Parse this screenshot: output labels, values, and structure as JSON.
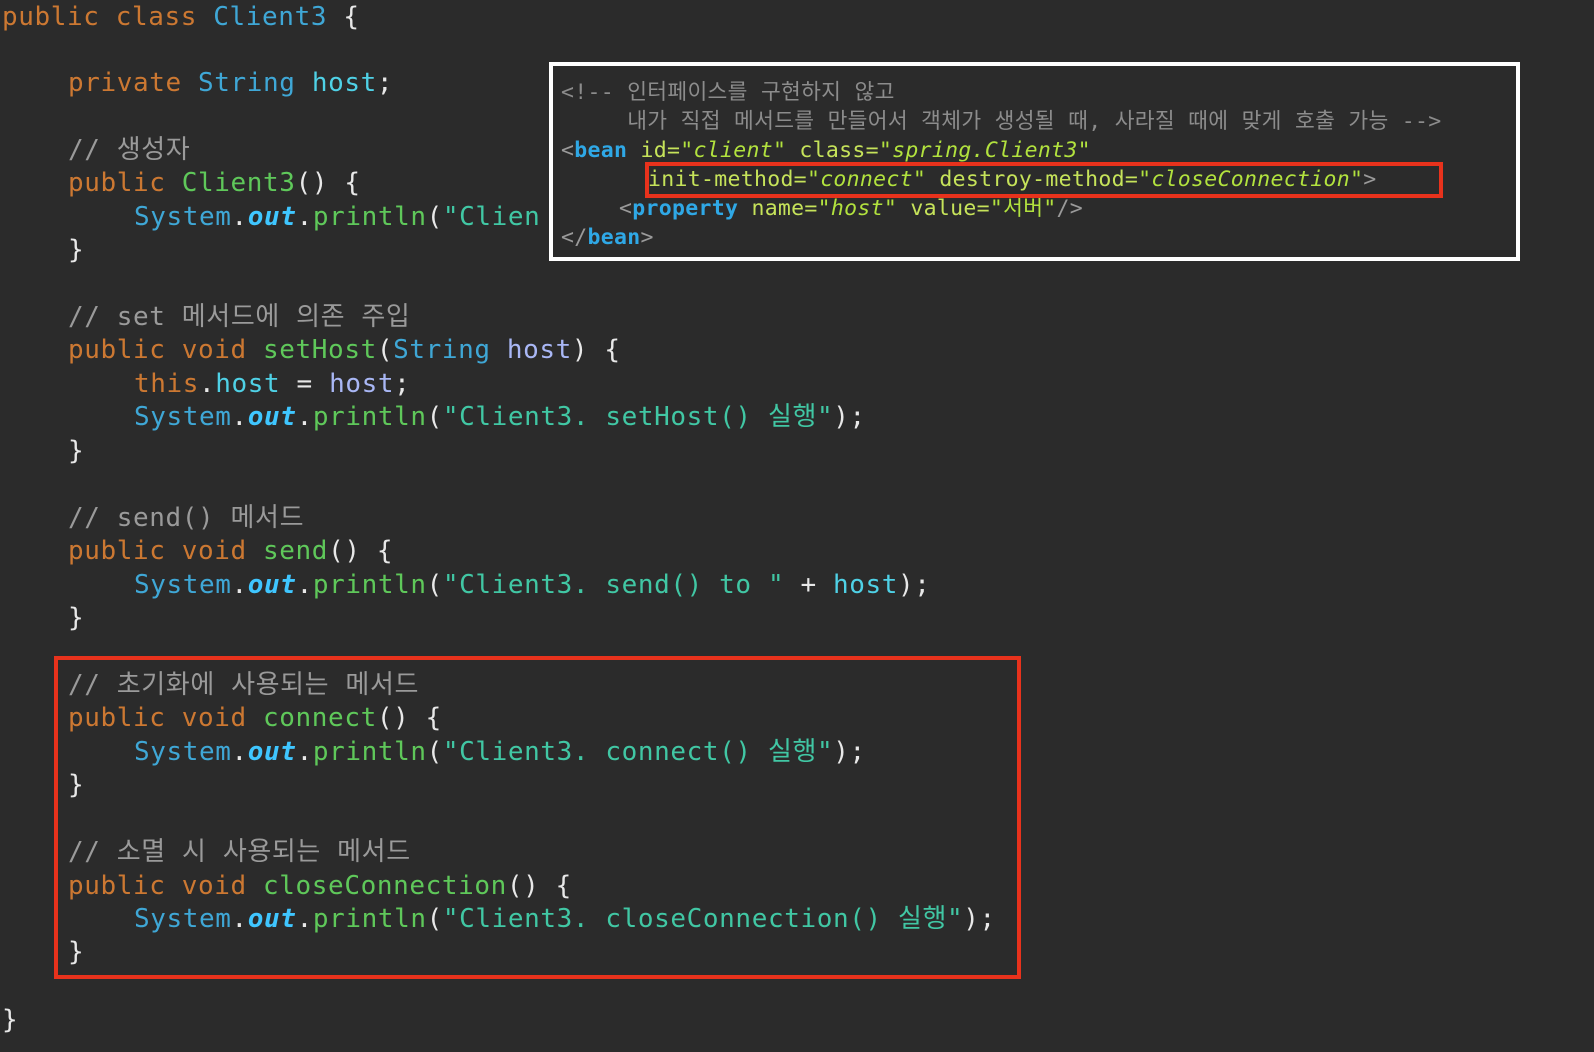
{
  "code": {
    "class_open": {
      "kw": "public class ",
      "name": "Client3",
      "brace": " {"
    },
    "field": {
      "kw": "private ",
      "type": "String",
      "name": "host",
      "semi": ";"
    },
    "ctor_comment": "// 생성자",
    "ctor_sig": {
      "kw": "public ",
      "name": "Client3",
      "rest": "() {"
    },
    "ctor_body": {
      "sys": "System",
      "dot1": ".",
      "out": "out",
      "dot2": ".",
      "println": "println",
      "paren": "(",
      "str": "\"Clien"
    },
    "close1": "}",
    "set_comment": "// set 메서드에 의존 주입",
    "set_sig": {
      "kw": "public void ",
      "name": "setHost",
      "p1": "(",
      "type": "String",
      "param": " host",
      "rest": ") {"
    },
    "set_body1": {
      "this": "this",
      "dot": ".",
      "field": "host",
      "eq": " = ",
      "param": "host",
      "semi": ";"
    },
    "set_body2": {
      "sys": "System",
      "dot1": ".",
      "out": "out",
      "dot2": ".",
      "println": "println",
      "paren": "(",
      "str": "\"Client3. setHost() 실행\"",
      "end": ");"
    },
    "close2": "}",
    "send_comment": "// send() 메서드",
    "send_sig": {
      "kw": "public void ",
      "name": "send",
      "rest": "() {"
    },
    "send_body": {
      "sys": "System",
      "dot1": ".",
      "out": "out",
      "dot2": ".",
      "println": "println",
      "paren": "(",
      "str": "\"Client3. send() to \"",
      "plus": " + ",
      "field": "host",
      "end": ");"
    },
    "close3": "}",
    "init_comment": "// 초기화에 사용되는 메서드",
    "connect_sig": {
      "kw": "public void ",
      "name": "connect",
      "rest": "() {"
    },
    "connect_body": {
      "sys": "System",
      "dot1": ".",
      "out": "out",
      "dot2": ".",
      "println": "println",
      "paren": "(",
      "str": "\"Client3. connect() 실행\"",
      "end": ");"
    },
    "close4": "}",
    "destroy_comment": "// 소멸 시 사용되는 메서드",
    "close_sig": {
      "kw": "public void ",
      "name": "closeConnection",
      "rest": "() {"
    },
    "close_body": {
      "sys": "System",
      "dot1": ".",
      "out": "out",
      "dot2": ".",
      "println": "println",
      "paren": "(",
      "str": "\"Client3. closeConnection() 실행\"",
      "end": ");"
    },
    "close5": "}",
    "class_close": "}"
  },
  "xml": {
    "comment1": "<!-- 인터페이스를 구현하지 않고",
    "comment2": "     내가 직접 메서드를 만들어서 객체가 생성될 때, 사라질 때에 맞게 호출 가능 -->",
    "bean_open": {
      "lt": "<",
      "tag": "bean",
      "a1": " id=",
      "v1q1": "\"",
      "v1": "client",
      "v1q2": "\"",
      "a2": " class=",
      "v2q1": "\"",
      "v2": "spring.Client3",
      "v2q2": "\""
    },
    "init_line": {
      "a1": "init-method=",
      "q1": "\"",
      "v1": "connect",
      "q2": "\"",
      "a2": " destroy-method=",
      "q3": "\"",
      "v2": "closeConnection",
      "q4": "\"",
      "gt": ">"
    },
    "property_line": {
      "lt": "<",
      "tag": "property",
      "a1": " name=",
      "q1": "\"",
      "v1": "host",
      "q2": "\"",
      "a2": " value=",
      "v2": "\"서버\"",
      "end": "/>"
    },
    "bean_close": {
      "lt": "</",
      "tag": "bean",
      "gt": ">"
    }
  },
  "colors": {
    "background": "#2b2b2b",
    "highlight_box": "#e8321c",
    "overlay_border": "#ffffff"
  }
}
